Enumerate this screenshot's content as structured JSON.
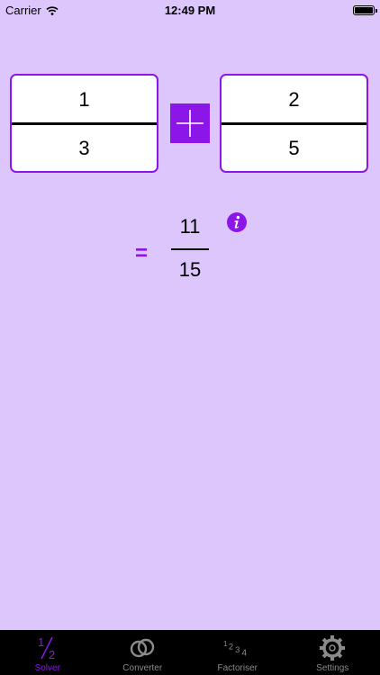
{
  "status_bar": {
    "carrier": "Carrier",
    "time": "12:49 PM"
  },
  "fraction_a": {
    "numerator": "1",
    "denominator": "3"
  },
  "operator": {
    "symbol": "+",
    "icon": "plus-icon"
  },
  "fraction_b": {
    "numerator": "2",
    "denominator": "5"
  },
  "result": {
    "equals": "=",
    "numerator": "11",
    "denominator": "15",
    "info_icon": "info-icon"
  },
  "tabs": [
    {
      "label": "Solver",
      "icon": "half-fraction-icon",
      "active": true
    },
    {
      "label": "Converter",
      "icon": "link-rings-icon",
      "active": false
    },
    {
      "label": "Factoriser",
      "icon": "numbers-1234-icon",
      "active": false
    },
    {
      "label": "Settings",
      "icon": "gear-icon",
      "active": false
    }
  ],
  "colors": {
    "background": "#dcc6fb",
    "accent": "#8c16e8",
    "tab_bar": "#000000",
    "tab_inactive": "#8a8a8a"
  }
}
